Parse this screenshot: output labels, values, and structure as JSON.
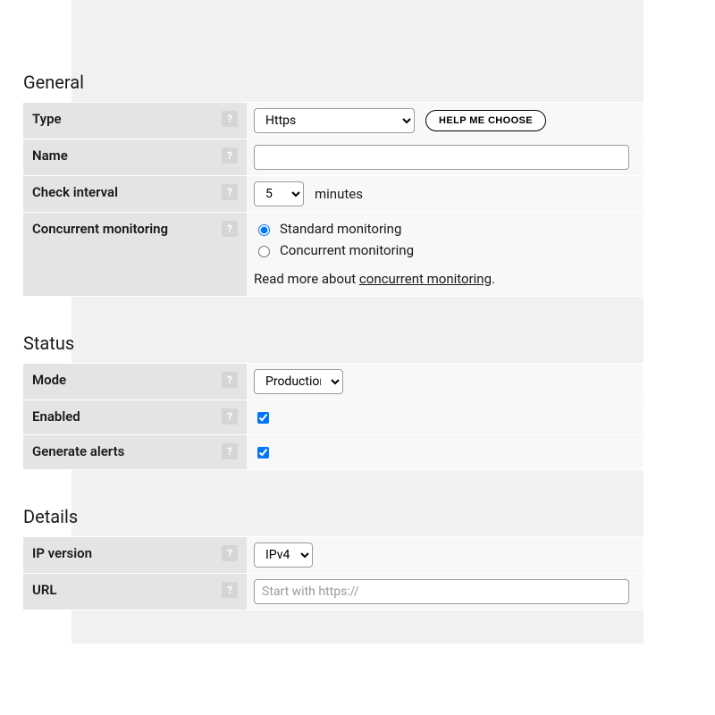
{
  "general": {
    "title": "General",
    "type": {
      "label": "Type",
      "value": "Https",
      "help_btn": "HELP ME CHOOSE"
    },
    "name": {
      "label": "Name",
      "value": ""
    },
    "interval": {
      "label": "Check interval",
      "value": "5",
      "unit": "minutes"
    },
    "concurrent": {
      "label": "Concurrent monitoring",
      "opt_standard": "Standard monitoring",
      "opt_concurrent": "Concurrent monitoring",
      "selected": "standard",
      "read_more_prefix": "Read more about ",
      "read_more_link": "concurrent monitoring",
      "read_more_suffix": "."
    }
  },
  "status": {
    "title": "Status",
    "mode": {
      "label": "Mode",
      "value": "Production"
    },
    "enabled": {
      "label": "Enabled",
      "checked": true
    },
    "alerts": {
      "label": "Generate alerts",
      "checked": true
    }
  },
  "details": {
    "title": "Details",
    "ip": {
      "label": "IP version",
      "value": "IPv4"
    },
    "url": {
      "label": "URL",
      "value": "",
      "placeholder": "Start with https://"
    }
  },
  "help_glyph": "?"
}
